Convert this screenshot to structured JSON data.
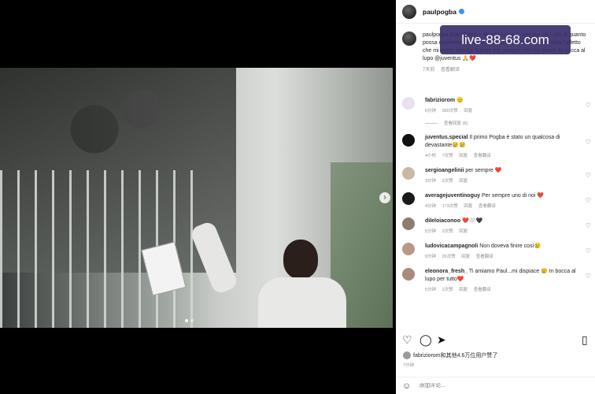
{
  "post": {
    "username": "paulpogba",
    "caption_text": "paulpogba Ciao Torino... tempo come ... con voi, ca... più di quanto possa esprimere a parole, e porterò sempre con me tutto l'affetto che mi avete donato. Sarete per sempre nel mio cuore. In bocca al lupo @juventus 🙏❤️",
    "caption_time": "7天前",
    "caption_translate": "查看翻译"
  },
  "watermark": "live-88-68.com",
  "comments": [
    {
      "user": "fabriziorom",
      "text": "🫡",
      "time": "6分钟",
      "likes": "390次赞",
      "reply": "回复",
      "avatar_color": "#e9e1f2"
    },
    {
      "user": "juventus.special",
      "text": "Il primo Pogba è stato un qualcosa di devastante😢😢",
      "time": "4小时",
      "likes": "7次赞",
      "reply": "回复",
      "translate": "查看翻译",
      "avatar_color": "#111111"
    },
    {
      "user": "sergioangelinii",
      "text": "per sempre ❤️",
      "time": "3分钟",
      "likes": "2次赞",
      "reply": "回复",
      "avatar_color": "#c9b8a6"
    },
    {
      "user": "averagejuventinoguy",
      "text": "Per sempre uno di noi ❤️",
      "time": "4分钟",
      "likes": "173次赞",
      "reply": "回复",
      "translate": "查看翻译",
      "avatar_color": "#1a1a1a"
    },
    {
      "user": "dileloiaconoo",
      "text": "❤️🤍🖤",
      "time": "5分钟",
      "likes": "2次赞",
      "reply": "回复",
      "avatar_color": "#8c7d72"
    },
    {
      "user": "ludovicacampagnoli",
      "text": "Non doveva finire così😢",
      "time": "6分钟",
      "likes": "29次赞",
      "reply": "回复",
      "translate": "查看翻译",
      "avatar_color": "#b59a86"
    },
    {
      "user": "eleonora_fresh_",
      "text": "Ti amiamo Paul...mi dispiace 😢 In bocca al lupo per tutto❤️",
      "time": "5分钟",
      "likes": "2次赞",
      "reply": "回复",
      "translate": "查看翻译",
      "avatar_color": "#a98b7c"
    }
  ],
  "view_replies": "查看回复 (6)",
  "likes_text": "fabriziorom和其他4.6万位用户赞了",
  "time_ago": "7分钟",
  "comment_placeholder": "添加评论...",
  "icons": {
    "like": "heart-icon",
    "comment": "comment-icon",
    "share": "send-icon",
    "save": "bookmark-icon",
    "emoji": "emoji-icon",
    "next": "chevron-right-icon"
  },
  "colors": {
    "verified": "#3797f0",
    "watermark_bg": "#3a2f6b"
  }
}
